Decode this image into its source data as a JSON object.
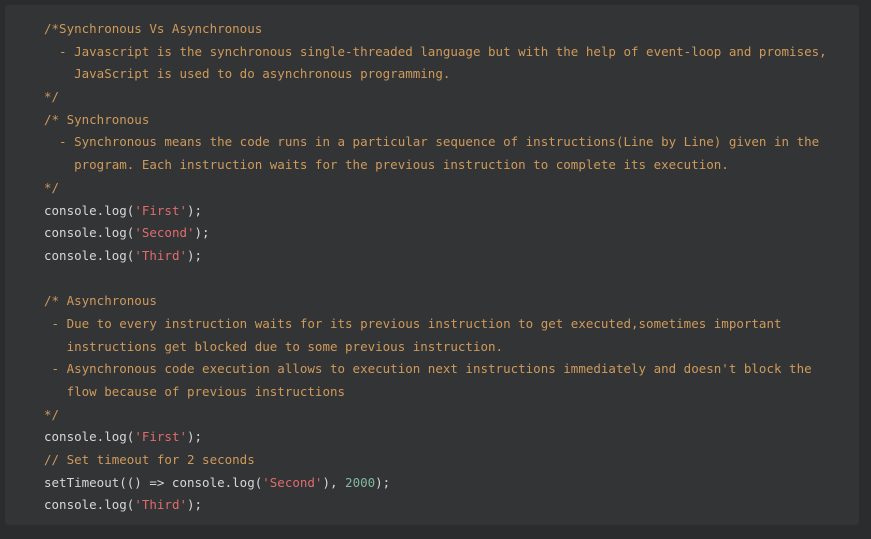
{
  "colors": {
    "background": "#2b2c2d",
    "code_background": "#323436",
    "comment": "#cf9a5a",
    "string": "#e06c6c",
    "number": "#82b99d",
    "text": "#d7d7d7"
  },
  "lines": [
    {
      "t": "c",
      "text": "/*Synchronous Vs Asynchronous"
    },
    {
      "t": "c",
      "text": "  - Javascript is the synchronous single-threaded language but with the help of event-loop and promises,"
    },
    {
      "t": "c",
      "text": "    JavaScript is used to do asynchronous programming."
    },
    {
      "t": "c",
      "text": "*/"
    },
    {
      "t": "c",
      "text": "/* Synchronous"
    },
    {
      "t": "c",
      "text": "  - Synchronous means the code runs in a particular sequence of instructions(Line by Line) given in the"
    },
    {
      "t": "c",
      "text": "    program. Each instruction waits for the previous instruction to complete its execution."
    },
    {
      "t": "c",
      "text": "*/"
    },
    {
      "t": "log",
      "pre": "console.log(",
      "str": "'First'",
      "post": ");"
    },
    {
      "t": "log",
      "pre": "console.log(",
      "str": "'Second'",
      "post": ");"
    },
    {
      "t": "log",
      "pre": "console.log(",
      "str": "'Third'",
      "post": ");"
    },
    {
      "t": "blank",
      "text": ""
    },
    {
      "t": "c",
      "text": "/* Asynchronous"
    },
    {
      "t": "c",
      "text": " - Due to every instruction waits for its previous instruction to get executed,sometimes important"
    },
    {
      "t": "c",
      "text": "   instructions get blocked due to some previous instruction."
    },
    {
      "t": "c",
      "text": " - Asynchronous code execution allows to execution next instructions immediately and doesn't block the"
    },
    {
      "t": "c",
      "text": "   flow because of previous instructions"
    },
    {
      "t": "c",
      "text": "*/"
    },
    {
      "t": "log",
      "pre": "console.log(",
      "str": "'First'",
      "post": ");"
    },
    {
      "t": "c",
      "text": "// Set timeout for 2 seconds"
    },
    {
      "t": "timeout",
      "pre": "setTimeout(() => console.log(",
      "str": "'Second'",
      "mid": "), ",
      "num": "2000",
      "post": ");"
    },
    {
      "t": "log",
      "pre": "console.log(",
      "str": "'Third'",
      "post": ");"
    }
  ]
}
